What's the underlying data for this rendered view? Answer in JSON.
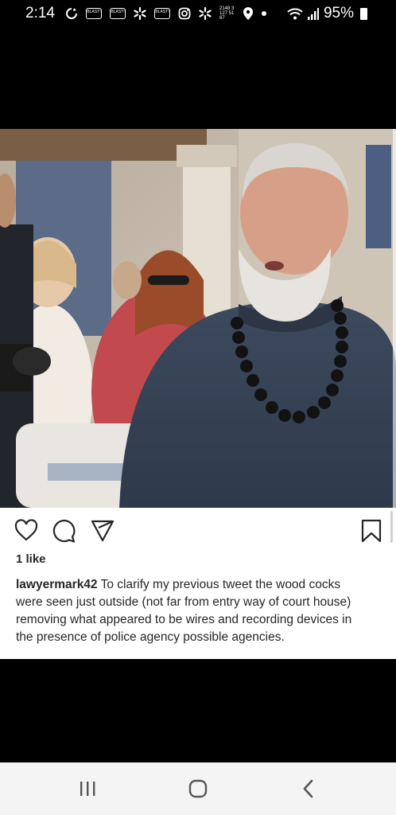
{
  "status_bar": {
    "time": "2:14",
    "battery": "95%",
    "icons": [
      "sync-icon",
      "blast-badge-icon",
      "blast-badge-icon",
      "walmart-spark-icon",
      "blast-badge-icon",
      "instagram-icon",
      "walmart-spark-icon",
      "grid-numbers-icon",
      "location-icon",
      "dot-icon",
      "wifi-icon",
      "signal-icon",
      "battery-icon"
    ],
    "badge_label": "BLAST!",
    "grid_numbers": "2148 3127 5167"
  },
  "post": {
    "likes": "1 like",
    "username": "lawyermark42",
    "caption": "To clarify my previous tweet the wood cocks were seen just outside (not far from entry way of court house) removing what appeared to be wires and recording devices in the presence of police agency possible agencies.",
    "actions": [
      "heart-icon",
      "comment-icon",
      "share-icon",
      "bookmark-icon"
    ]
  },
  "nav_bar": {
    "buttons": [
      "recent-apps-icon",
      "home-icon",
      "back-icon"
    ]
  }
}
